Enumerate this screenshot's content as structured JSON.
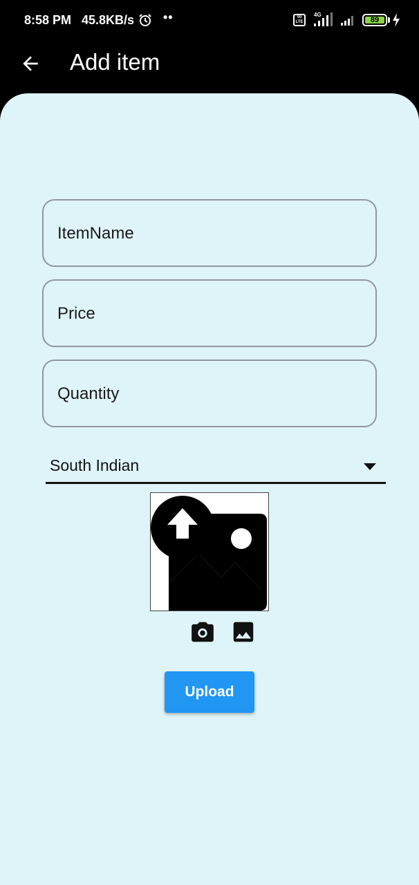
{
  "status_bar": {
    "time": "8:58 PM",
    "speed": "45.8KB/s",
    "dots": "••",
    "volte": "Vo LTE",
    "network": "4G",
    "battery": "89",
    "battery_color": "#8bd34a"
  },
  "app_bar": {
    "title": "Add item",
    "back_icon": "arrow-back-icon"
  },
  "form": {
    "item_name_placeholder": "ItemName",
    "price_placeholder": "Price",
    "quantity_placeholder": "Quantity",
    "category_selected": "South Indian",
    "image_placeholder_icon": "image-upload-icon",
    "camera_icon": "camera-icon",
    "gallery_icon": "gallery-icon",
    "upload_label": "Upload"
  },
  "colors": {
    "background": "#dff4f8",
    "accent": "#2196f3",
    "app_bar": "#000000"
  }
}
